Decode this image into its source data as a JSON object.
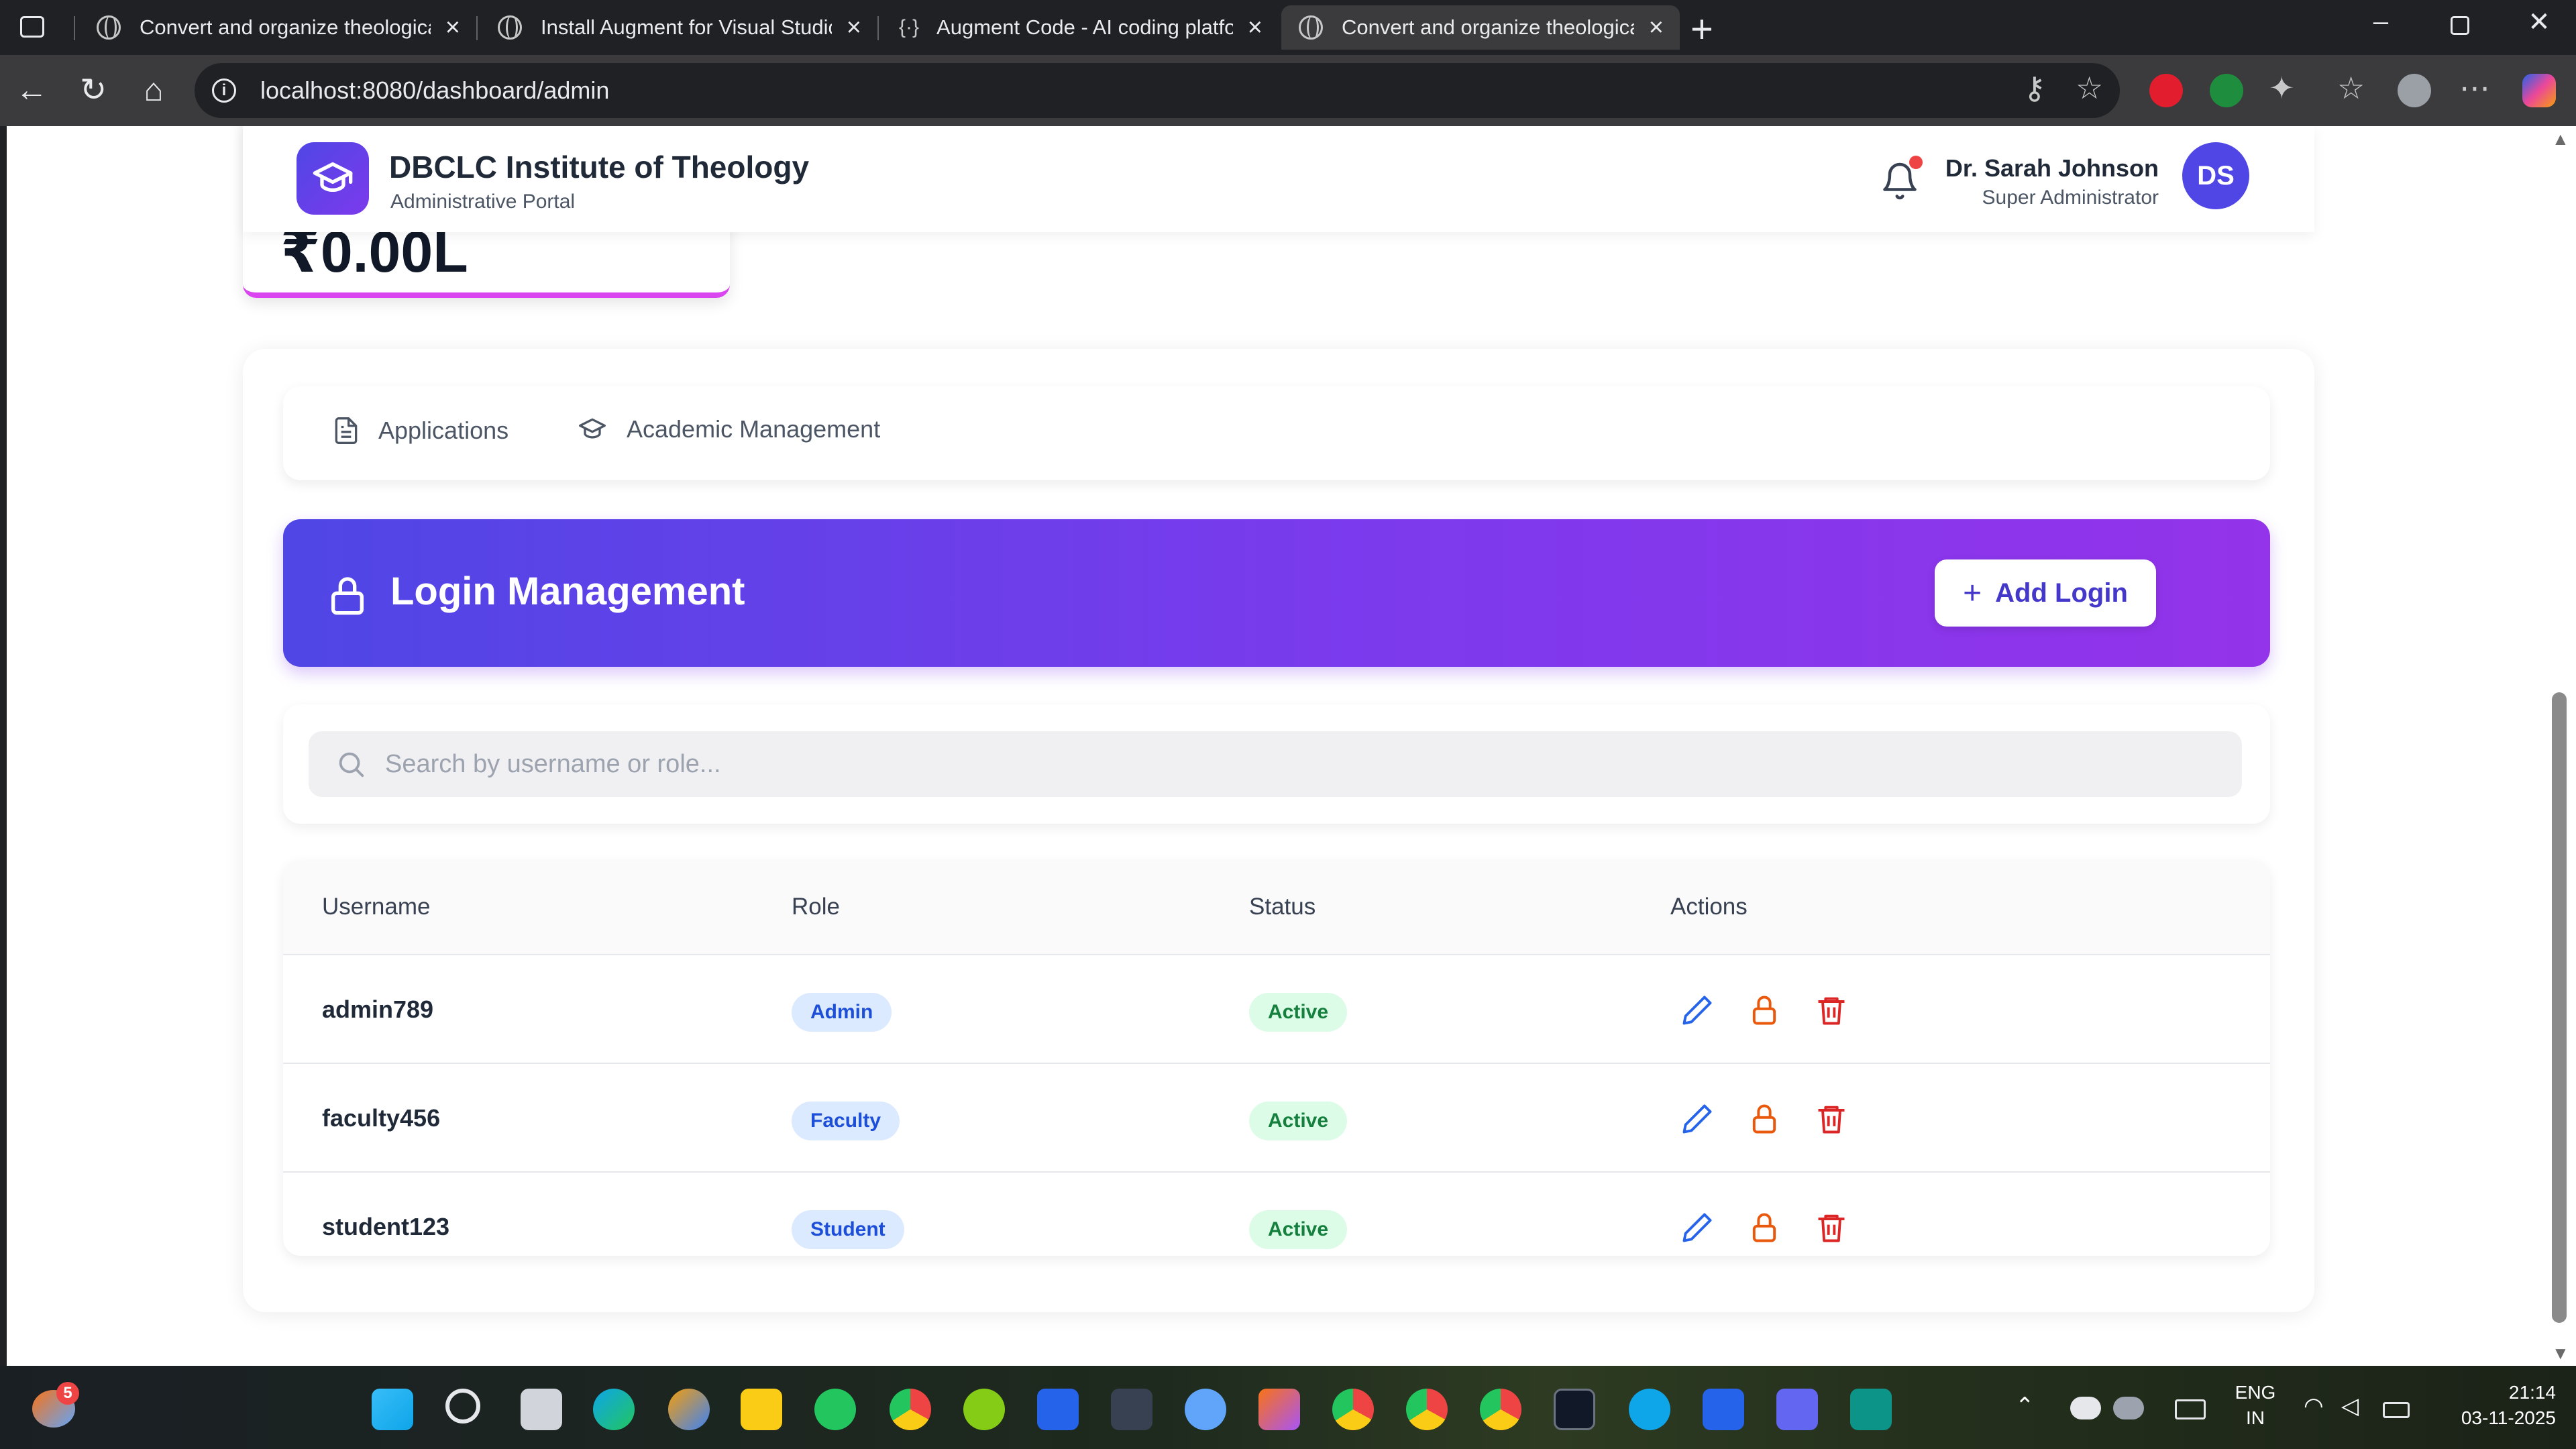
{
  "browser": {
    "tabs": [
      {
        "title": "Convert and organize theological",
        "active": false
      },
      {
        "title": "Install Augment for Visual Studio",
        "active": false
      },
      {
        "title": "Augment Code - AI coding platfo",
        "active": false
      },
      {
        "title": "Convert and organize theological",
        "active": true
      }
    ],
    "url": "localhost:8080/dashboard/admin"
  },
  "header": {
    "brand_name": "DBCLC Institute of Theology",
    "brand_sub": "Administrative Portal",
    "user_name": "Dr. Sarah Johnson",
    "user_role": "Super Administrator",
    "avatar_initials": "DS"
  },
  "stat_card": {
    "value": "₹0.00L"
  },
  "tabs": [
    {
      "label": "Applications",
      "icon": "document-icon"
    },
    {
      "label": "Academic Management",
      "icon": "graduation-cap-icon"
    }
  ],
  "login_management": {
    "title": "Login Management",
    "add_button_label": "Add Login",
    "search_placeholder": "Search by username or role...",
    "columns": [
      "Username",
      "Role",
      "Status",
      "Actions"
    ],
    "rows": [
      {
        "username": "admin789",
        "role": "Admin",
        "status": "Active"
      },
      {
        "username": "faculty456",
        "role": "Faculty",
        "status": "Active"
      },
      {
        "username": "student123",
        "role": "Student",
        "status": "Active"
      }
    ]
  },
  "taskbar": {
    "notification_count": "5",
    "language_line1": "ENG",
    "language_line2": "IN",
    "time": "21:14",
    "date": "03-11-2025"
  },
  "colors": {
    "accent": "#4f46e5",
    "banner_end": "#9333ea",
    "role_badge": "#dbeafe",
    "status_badge": "#dcfce7",
    "edit_icon": "#2563eb",
    "lock_icon": "#ea580c",
    "delete_icon": "#dc2626"
  }
}
